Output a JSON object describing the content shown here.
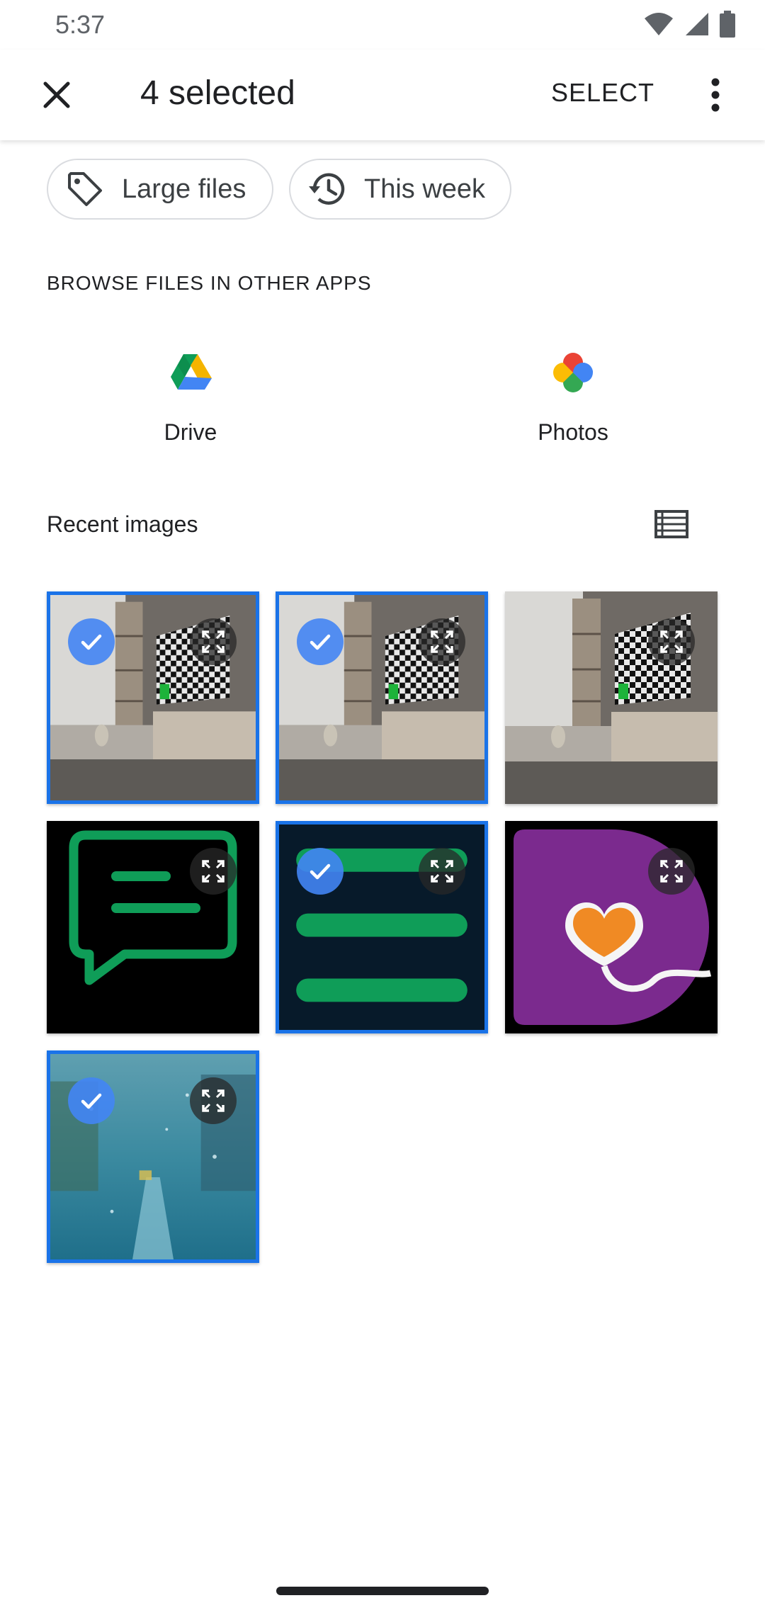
{
  "status": {
    "time": "5:37"
  },
  "app_bar": {
    "title": "4 selected",
    "select_label": "SELECT"
  },
  "filters": [
    {
      "label": "Large files",
      "icon": "tag-icon"
    },
    {
      "label": "This week",
      "icon": "history-icon"
    }
  ],
  "browse": {
    "heading": "BROWSE FILES IN OTHER APPS",
    "apps": [
      {
        "label": "Drive",
        "icon": "google-drive-icon"
      },
      {
        "label": "Photos",
        "icon": "google-photos-icon"
      }
    ]
  },
  "recent": {
    "heading": "Recent images",
    "images": [
      {
        "subject": "room-tv",
        "selected": true
      },
      {
        "subject": "room-tv",
        "selected": true
      },
      {
        "subject": "room-tv",
        "selected": false
      },
      {
        "subject": "chat-bubble",
        "selected": false
      },
      {
        "subject": "list-lines",
        "selected": true
      },
      {
        "subject": "heart-app",
        "selected": false
      },
      {
        "subject": "rainy-street",
        "selected": true
      }
    ]
  },
  "colors": {
    "accent": "#1a73e8",
    "check_fill": "#4285f4"
  }
}
